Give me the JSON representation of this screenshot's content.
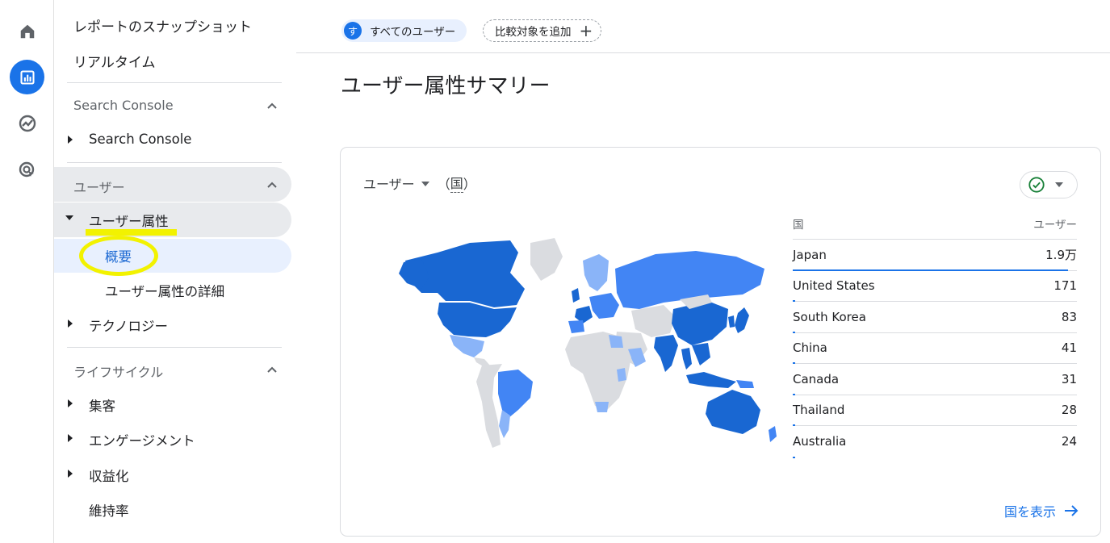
{
  "rail": {
    "icons": [
      "home-icon",
      "reports-icon",
      "explore-icon",
      "advertising-icon"
    ]
  },
  "nav": {
    "snapshot": "レポートのスナップショット",
    "realtime": "リアルタイム",
    "sections": [
      {
        "title": "Search Console",
        "items": [
          {
            "label": "Search Console"
          }
        ]
      },
      {
        "title": "ユーザー",
        "items": [
          {
            "label": "ユーザー属性",
            "children": [
              {
                "label": "概要"
              },
              {
                "label": "ユーザー属性の詳細"
              }
            ]
          },
          {
            "label": "テクノロジー"
          }
        ]
      },
      {
        "title": "ライフサイクル",
        "items": [
          {
            "label": "集客"
          },
          {
            "label": "エンゲージメント"
          },
          {
            "label": "収益化"
          },
          {
            "label": "維持率"
          }
        ]
      }
    ]
  },
  "topbar": {
    "segment_avatar": "す",
    "segment_label": "すべてのユーザー",
    "add_comparison": "比較対象を追加",
    "add_icon": "+"
  },
  "page": {
    "title": "ユーザー属性サマリー"
  },
  "card": {
    "metric": "ユーザー",
    "dimension_open": "（",
    "dimension": "国",
    "dimension_close": "）",
    "table_header": {
      "col1": "国",
      "col2": "ユーザー"
    },
    "rows": [
      {
        "country": "Japan",
        "value": "1.9万",
        "share": 0.97
      },
      {
        "country": "United States",
        "value": "171",
        "share": 0.009
      },
      {
        "country": "South Korea",
        "value": "83",
        "share": 0.004
      },
      {
        "country": "China",
        "value": "41",
        "share": 0.002
      },
      {
        "country": "Canada",
        "value": "31",
        "share": 0.002
      },
      {
        "country": "Thailand",
        "value": "28",
        "share": 0.0015
      },
      {
        "country": "Australia",
        "value": "24",
        "share": 0.0012
      }
    ],
    "view_link": "国を表示",
    "colors": {
      "dark": "#1967d2",
      "mid": "#4285f4",
      "light": "#8ab4f8",
      "none": "#dadce0"
    }
  }
}
